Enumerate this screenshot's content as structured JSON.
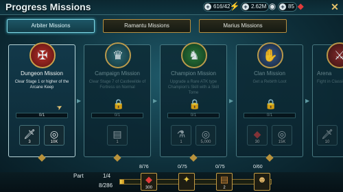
{
  "header": {
    "title": "Progress Missions",
    "resources": [
      {
        "value": "616/42",
        "icon": "energy-bolt-icon",
        "color": "#9be43a"
      },
      {
        "value": "2.62M",
        "icon": "silver-coins-icon",
        "color": "#d8e0e4"
      },
      {
        "value": "85",
        "icon": "gem-ruby-icon",
        "color": "#e23b3b"
      }
    ],
    "close_icon": "close-icon"
  },
  "tabs": [
    {
      "label": "Arbiter Missions",
      "active": true
    },
    {
      "label": "Ramantu Missions",
      "active": false
    },
    {
      "label": "Marius Missions",
      "active": false
    }
  ],
  "missions": [
    {
      "name": "Dungeon Mission",
      "description": "Clear Stage 1 or higher of the Arcane Keep",
      "progress": "0/1",
      "locked": false,
      "emblem_icon": "dungeon-emblem-icon",
      "rewards": [
        {
          "icon": "silver-shard-icon",
          "amount": "3"
        },
        {
          "icon": "silver-coin-icon",
          "amount": "10K"
        }
      ]
    },
    {
      "name": "Campaign Mission",
      "description": "Clear Stage 7 of Castlewilde of Fortress on Normal",
      "progress": "0/1",
      "locked": true,
      "emblem_icon": "campaign-emblem-icon",
      "rewards": [
        {
          "icon": "tome-icon",
          "amount": "1"
        }
      ]
    },
    {
      "name": "Champion Mission",
      "description": "Upgrade a Rare ATK type Champion's Skill with a Skill Tome",
      "progress": "0/1",
      "locked": true,
      "emblem_icon": "champion-emblem-icon",
      "rewards": [
        {
          "icon": "potion-icon",
          "amount": "1"
        },
        {
          "icon": "silver-coin-icon",
          "amount": "5,000"
        }
      ]
    },
    {
      "name": "Clan Mission",
      "description": "Get a Rebirth Loot",
      "progress": "0/1",
      "locked": true,
      "emblem_icon": "clan-emblem-icon",
      "rewards": [
        {
          "icon": "ruby-icon",
          "amount": "30"
        },
        {
          "icon": "silver-coin-icon",
          "amount": "15K"
        }
      ]
    },
    {
      "name": "Arena",
      "description": "Fight in Classic Arena",
      "progress": "",
      "locked": true,
      "emblem_icon": "arena-emblem-icon",
      "rewards": [
        {
          "icon": "silver-shard-icon",
          "amount": "10"
        }
      ]
    }
  ],
  "part": {
    "label": "Part",
    "value": "1/4",
    "total": "8/286",
    "fill_fraction": 0.028
  },
  "milestones": [
    {
      "count": "8/76",
      "icon": "ruby-icon",
      "amount": "300"
    },
    {
      "count": "0/75",
      "icon": "shard-icon",
      "amount": ""
    },
    {
      "count": "0/75",
      "icon": "book-icon",
      "amount": "2"
    },
    {
      "count": "0/60",
      "icon": "champion-portrait-icon",
      "amount": ""
    }
  ]
}
